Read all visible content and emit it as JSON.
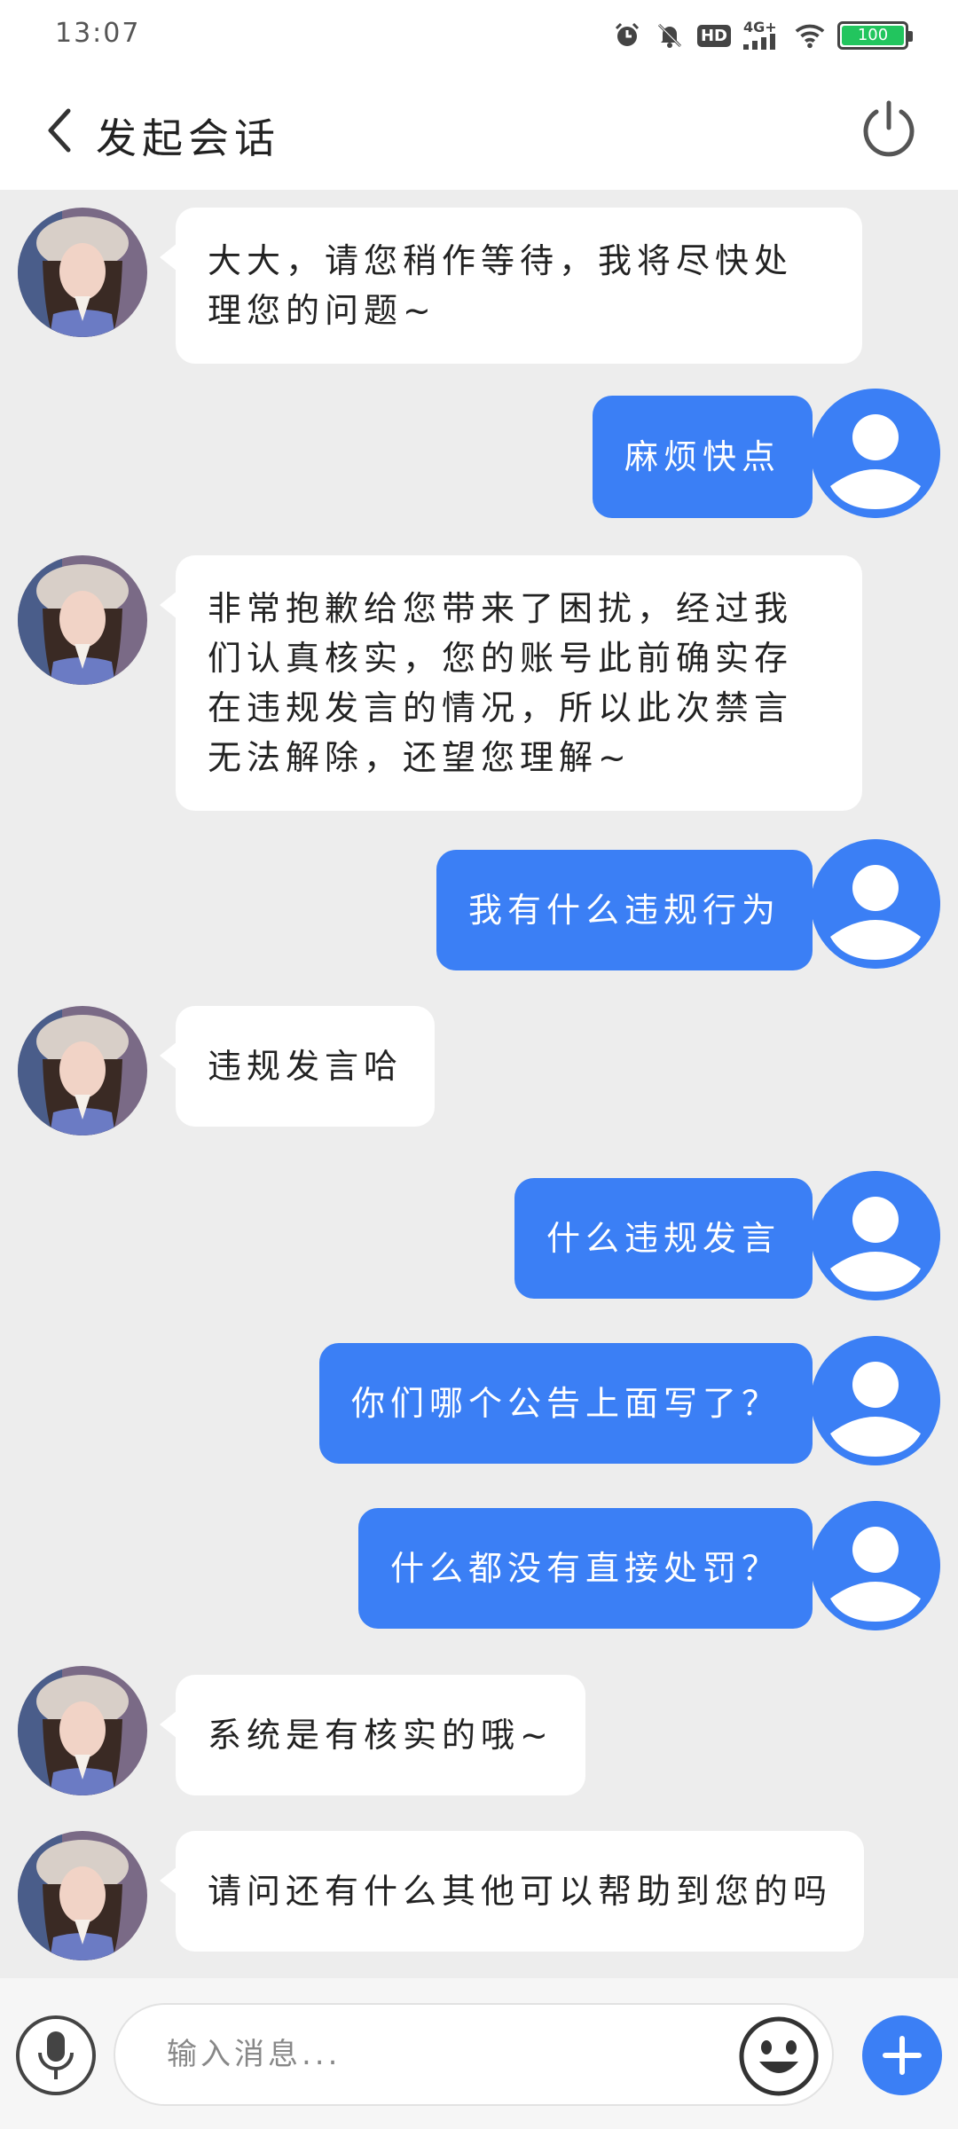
{
  "status_bar": {
    "time": "13:07",
    "network_label": "4G+",
    "hd_label": "HD",
    "battery_label": "100",
    "icons": [
      "alarm-icon",
      "mute-icon",
      "hd-icon",
      "signal-icon",
      "wifi-icon",
      "battery-icon"
    ]
  },
  "header": {
    "title": "发起会话",
    "back_icon": "chevron-left-icon",
    "power_icon": "power-icon"
  },
  "colors": {
    "accent": "#3b7ff5",
    "chat_bg": "#ededed",
    "bubble_in": "#ffffff",
    "battery": "#22c55e"
  },
  "messages": [
    {
      "side": "in",
      "text": "大大，请您稍作等待，我将尽快处理您的问题~"
    },
    {
      "side": "out",
      "text": "麻烦快点"
    },
    {
      "side": "in",
      "text": "非常抱歉给您带来了困扰，经过我们认真核实，您的账号此前确实存在违规发言的情况，所以此次禁言无法解除，还望您理解~"
    },
    {
      "side": "out",
      "text": "我有什么违规行为"
    },
    {
      "side": "in",
      "text": "违规发言哈"
    },
    {
      "side": "out",
      "text": "什么违规发言"
    },
    {
      "side": "out",
      "text": "你们哪个公告上面写了？"
    },
    {
      "side": "out",
      "text": "什么都没有直接处罚？"
    },
    {
      "side": "in",
      "text": "系统是有核实的哦~"
    },
    {
      "side": "in",
      "text": "请问还有什么其他可以帮助到您的吗"
    }
  ],
  "input_bar": {
    "placeholder": "输入消息...",
    "mic_icon": "microphone-icon",
    "emoji_icon": "emoji-icon",
    "plus_icon": "plus-icon"
  }
}
